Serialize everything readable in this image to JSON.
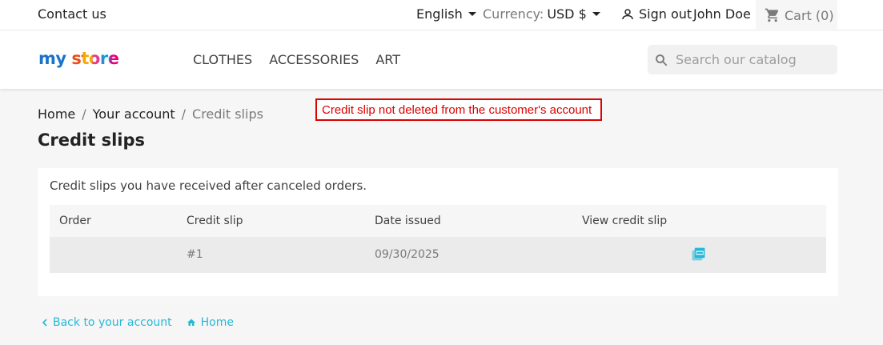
{
  "topbar": {
    "contact": "Contact us",
    "language": "English",
    "currency_label": "Currency:",
    "currency_value": "USD $",
    "signout": "Sign out",
    "username": "John Doe",
    "cart": "Cart (0)"
  },
  "header": {
    "logo_word1": "my",
    "logo_word2": "store",
    "nav": [
      "CLOTHES",
      "ACCESSORIES",
      "ART"
    ],
    "search_placeholder": "Search our catalog"
  },
  "breadcrumb": {
    "home": "Home",
    "account": "Your account",
    "current": "Credit slips",
    "sep": "/"
  },
  "alert": "Credit slip not deleted from the customer's account",
  "page": {
    "title": "Credit slips",
    "intro": "Credit slips you have received after canceled orders.",
    "columns": [
      "Order",
      "Credit slip",
      "Date issued",
      "View credit slip"
    ],
    "rows": [
      {
        "order": "",
        "credit_slip": "#1",
        "date_issued": "09/30/2025"
      }
    ]
  },
  "footer_links": {
    "back": "Back to your account",
    "home": "Home"
  },
  "colors": {
    "accent": "#24b9d7",
    "alert": "#dd0000"
  }
}
